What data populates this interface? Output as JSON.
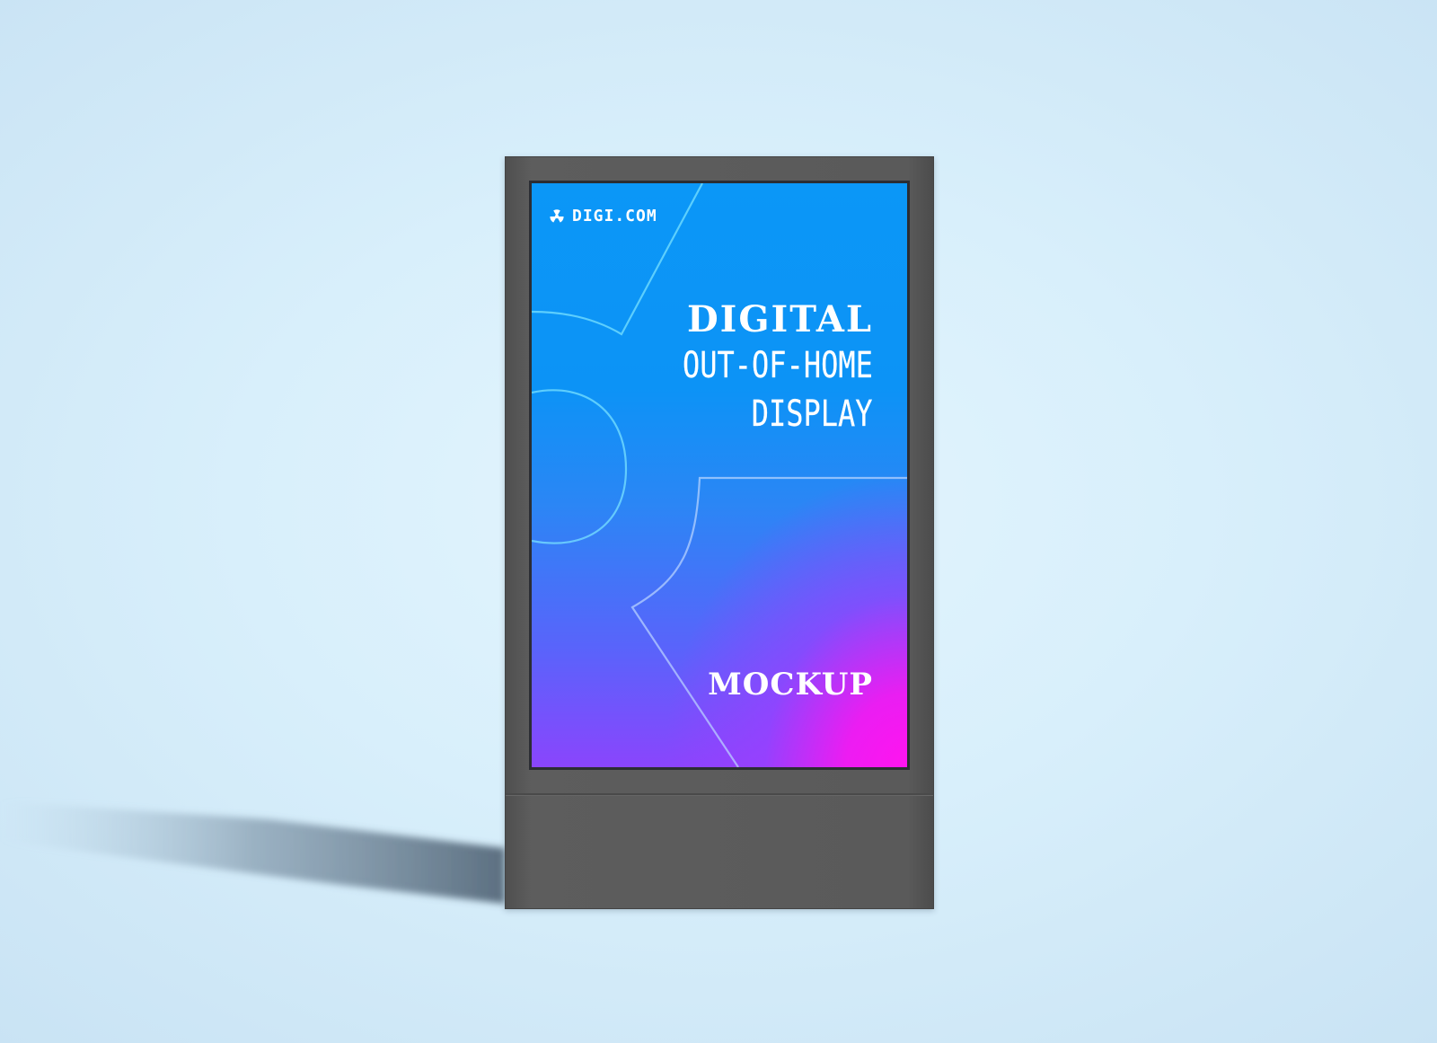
{
  "scene": {
    "background_color": "#d8effb",
    "kiosk_color": "#5a5a5a",
    "bezel_color": "#2b2d33"
  },
  "screen": {
    "logo": {
      "icon": "radiation-icon",
      "text": "DIGI.COM"
    },
    "headline": "DIGITAL",
    "subline_1": "OUT-OF-HOME",
    "subline_2": "DISPLAY",
    "footer": "MOCKUP",
    "gradient_colors": [
      "#0b97f7",
      "#5a63fb",
      "#ff14f0"
    ]
  }
}
